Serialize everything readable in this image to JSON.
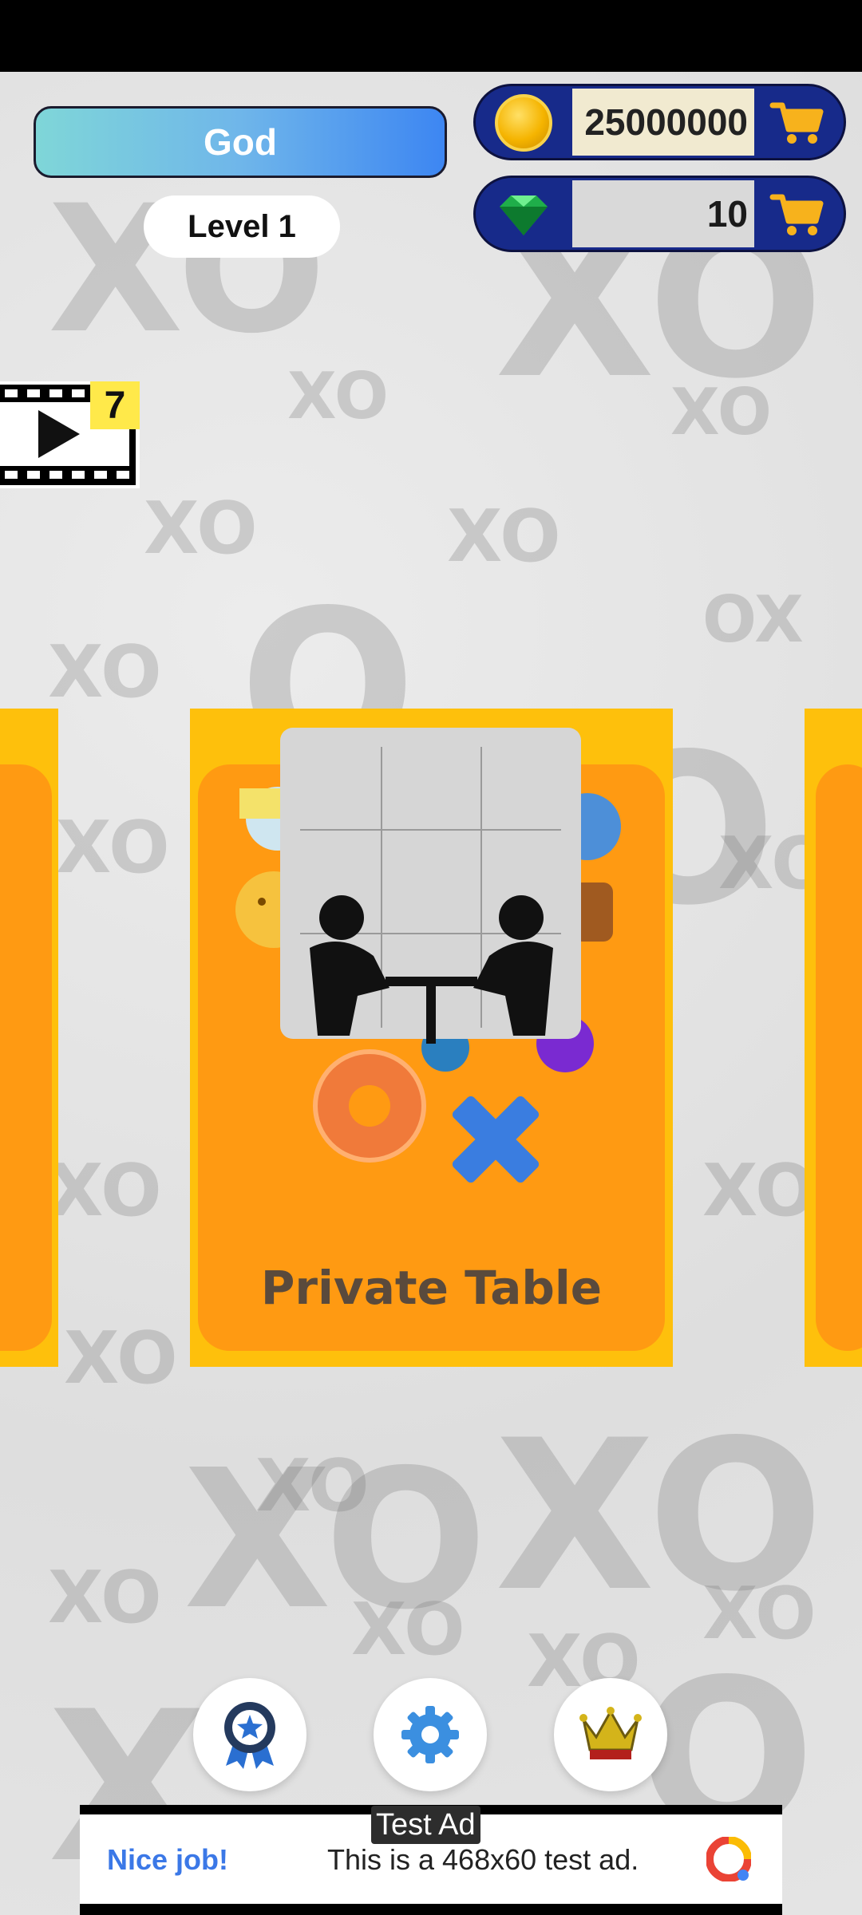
{
  "player": {
    "name": "God",
    "level": "Level 1"
  },
  "currency": {
    "coins": {
      "icon": "coin-icon",
      "value": "25000000"
    },
    "gems": {
      "icon": "gem-icon",
      "value": "10"
    }
  },
  "video_reward": {
    "count": "7"
  },
  "card": {
    "title": "Private Table"
  },
  "bottom_nav": [
    {
      "icon": "award-ribbon-icon"
    },
    {
      "icon": "gear-icon"
    },
    {
      "icon": "crown-icon"
    }
  ],
  "ad": {
    "tag": "Test Ad",
    "headline": "Nice job!",
    "text": "This is a 468x60 test ad."
  },
  "colors": {
    "card_outer": "#fec00c",
    "card_inner": "#ff9a12",
    "currency_bar": "#172a8a",
    "name_gradient_end": "#3d86f2"
  }
}
